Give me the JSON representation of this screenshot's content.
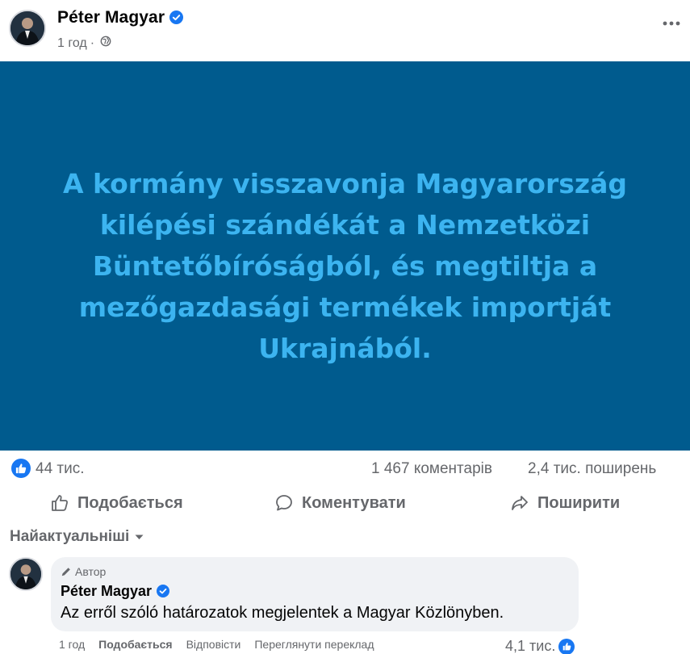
{
  "post": {
    "author": "Péter Magyar",
    "time": "1 год",
    "separator": "·",
    "audience_icon": "globe-icon",
    "banner_text": "A kormány visszavonja Magyarország kilépési szándékát a Nemzetközi Büntetőbíróságból, és megtiltja a mezőgazdasági termékek importját Ukrajnából.",
    "banner_bg_color": "#005b8e",
    "banner_text_color": "#3cb4f0"
  },
  "stats": {
    "reactions": "44 тис.",
    "comments": "1 467 коментарів",
    "shares": "2,4 тис. поширень"
  },
  "actions": {
    "like": "Подобається",
    "comment": "Коментувати",
    "share": "Поширити"
  },
  "comments_section": {
    "sort_label": "Найактуальніші"
  },
  "comment": {
    "badge": "Автор",
    "author": "Péter Magyar",
    "text": "Az erről szóló határozatok megjelentek a Magyar Közlönyben.",
    "time": "1 год",
    "like": "Подобається",
    "reply": "Відповісти",
    "translate": "Переглянути переклад",
    "likes": "4,1 тис."
  },
  "colors": {
    "accent": "#1877f2",
    "secondary_text": "#65676b",
    "bubble_bg": "#f0f2f5"
  }
}
